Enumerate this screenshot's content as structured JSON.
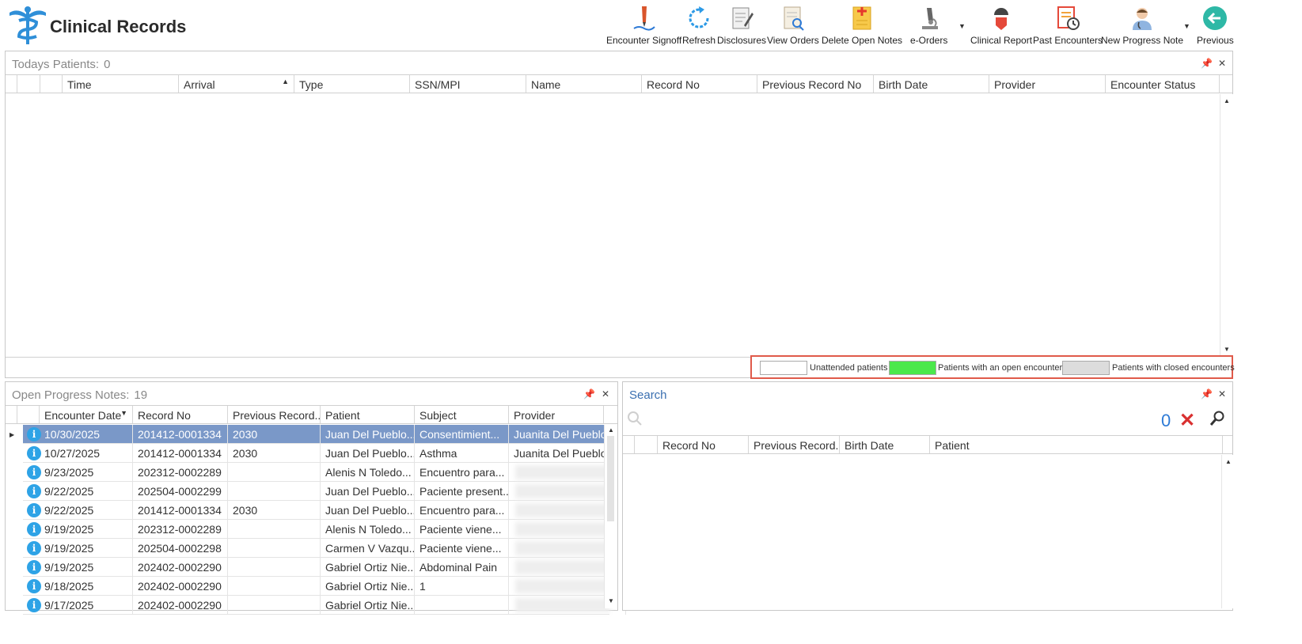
{
  "app": {
    "title": "Clinical Records"
  },
  "toolbar": {
    "encounter_signoff": "Encounter Signoff",
    "refresh": "Refresh",
    "disclosures": "Disclosures",
    "view_orders": "View Orders",
    "delete_open_notes": "Delete Open Notes",
    "e_orders": "e-Orders",
    "clinical_report": "Clinical Report",
    "past_encounters": "Past Encounters",
    "new_progress_note": "New Progress Note",
    "previous": "Previous"
  },
  "todays_patients": {
    "title": "Todays Patients:",
    "count": "0",
    "columns": [
      "Time",
      "Arrival",
      "Type",
      "SSN/MPI",
      "Name",
      "Record No",
      "Previous Record No",
      "Birth Date",
      "Provider",
      "Encounter Status"
    ]
  },
  "legend": {
    "unattended": "Unattended patients",
    "open_encounter": "Patients with an open encounter",
    "closed_encounters": "Patients with closed encounters",
    "colors": {
      "unattended": "#ffffff",
      "open": "#4be84b",
      "closed": "#dcdcdc"
    }
  },
  "open_notes": {
    "title": "Open Progress Notes:",
    "count": "19",
    "columns": [
      "Encounter Date",
      "Record No",
      "Previous Record...",
      "Patient",
      "Subject",
      "Provider"
    ],
    "rows": [
      {
        "date": "10/30/2025",
        "record": "201412-0001334",
        "prev": "2030",
        "patient": "Juan Del Pueblo...",
        "subject": "Consentimient...",
        "provider": "Juanita Del Pueblo",
        "selected": true
      },
      {
        "date": "10/27/2025",
        "record": "201412-0001334",
        "prev": "2030",
        "patient": "Juan Del Pueblo...",
        "subject": "Asthma",
        "provider": "Juanita Del Pueblo"
      },
      {
        "date": "9/23/2025",
        "record": "202312-0002289",
        "prev": "",
        "patient": "Alenis N Toledo...",
        "subject": "Encuentro para...",
        "provider": ""
      },
      {
        "date": "9/22/2025",
        "record": "202504-0002299",
        "prev": "",
        "patient": "Juan Del Pueblo...",
        "subject": "Paciente present...",
        "provider": ""
      },
      {
        "date": "9/22/2025",
        "record": "201412-0001334",
        "prev": "2030",
        "patient": "Juan Del Pueblo...",
        "subject": "Encuentro para...",
        "provider": ""
      },
      {
        "date": "9/19/2025",
        "record": "202312-0002289",
        "prev": "",
        "patient": "Alenis N Toledo...",
        "subject": "Paciente viene...",
        "provider": ""
      },
      {
        "date": "9/19/2025",
        "record": "202504-0002298",
        "prev": "",
        "patient": "Carmen V Vazqu...",
        "subject": "Paciente viene...",
        "provider": ""
      },
      {
        "date": "9/19/2025",
        "record": "202402-0002290",
        "prev": "",
        "patient": "Gabriel Ortiz Nie...",
        "subject": "Abdominal Pain",
        "provider": ""
      },
      {
        "date": "9/18/2025",
        "record": "202402-0002290",
        "prev": "",
        "patient": "Gabriel Ortiz Nie...",
        "subject": "1",
        "provider": ""
      },
      {
        "date": "9/17/2025",
        "record": "202402-0002290",
        "prev": "",
        "patient": "Gabriel Ortiz Nie...",
        "subject": "",
        "provider": ""
      }
    ]
  },
  "search": {
    "title": "Search",
    "count": "0",
    "columns": [
      "Record No",
      "Previous Record...",
      "Birth Date",
      "Patient"
    ]
  }
}
